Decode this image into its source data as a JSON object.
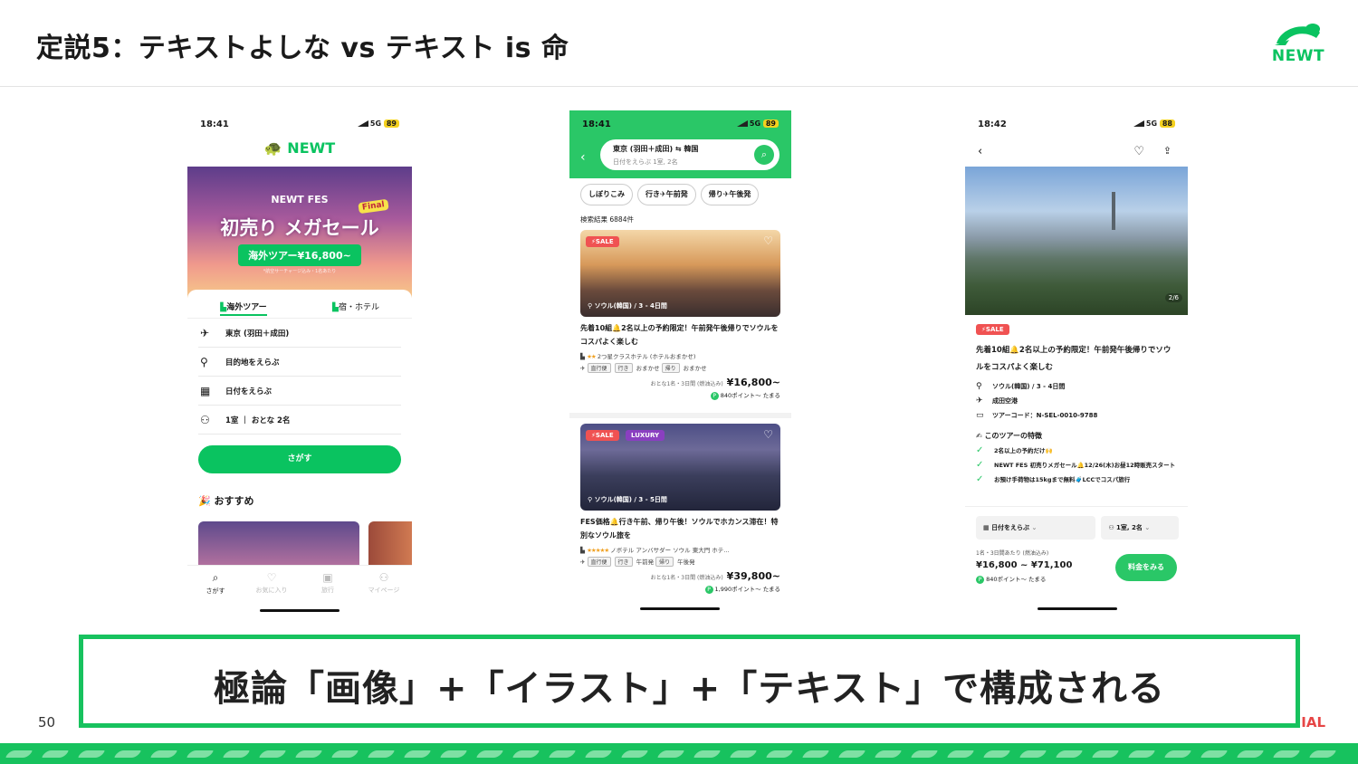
{
  "slide": {
    "title": "定説5：テキストよしな vs テキスト is 命",
    "logo_text": "NEWT",
    "callout": "極論「画像」+「イラスト」+「テキスト」で構成される",
    "page_number": "50",
    "confidential_label": "IAL",
    "accent_color": "#17c25e"
  },
  "phone1": {
    "time": "18:41",
    "network": "5G",
    "battery": "89",
    "app_logo": "NEWT",
    "banner": {
      "fes": "NEWT FES",
      "final": "Final",
      "headline": "初売り メガセール",
      "price": "海外ツアー¥16,800~",
      "note": "*航空サーチャージ込み・1名あたり"
    },
    "tabs": [
      "海外ツアー",
      "宿・ホテル"
    ],
    "fields": [
      "東京 (羽田＋成田)",
      "目的地をえらぶ",
      "日付をえらぶ",
      "1室 ｜ おとな 2名"
    ],
    "search_button": "さがす",
    "recommend_title": "おすすめ",
    "tabbar": [
      "さがす",
      "お気に入り",
      "旅行",
      "マイページ"
    ]
  },
  "phone2": {
    "time": "18:41",
    "network": "5G",
    "battery": "89",
    "search_line1": "東京 (羽田＋成田) ⇆ 韓国",
    "search_line2": "日付をえらぶ 1室, 2名",
    "chips": [
      "しぼりこみ",
      "行き✈午前発",
      "帰り✈午後発"
    ],
    "result_count": "検索結果 6884件",
    "cards": [
      {
        "sale": "SALE",
        "location": "ソウル(韓国) / 3 - 4日間",
        "title": "先着10組🔔2名以上の予約限定！午前発午後帰りでソウルをコスパよく楽しむ",
        "hotel": "2つ星クラスホテル (ホテルおまかせ)",
        "stars": "★★",
        "tag1": "直行便",
        "tag2": "行き",
        "out": "おまかせ",
        "tag3": "帰り",
        "ret": "おまかせ",
        "price_note": "おとな1名・3日間 (燃油込み)",
        "price": "¥16,800~",
        "points": "840ポイント～ たまる"
      },
      {
        "sale": "SALE",
        "luxury": "LUXURY",
        "location": "ソウル(韓国) / 3 - 5日間",
        "title": "FES価格🔔行き午前、帰り午後！ソウルでホカンス滞在！特別なソウル旅を",
        "hotel": "ノボテル アンバサダー ソウル 東大門 ホテ…",
        "stars": "★★★★★",
        "tag1": "直行便",
        "tag2": "行き",
        "out": "午前発",
        "tag3": "帰り",
        "ret": "午後発",
        "price_note": "おとな1名・3日間 (燃油込み)",
        "price": "¥39,800~",
        "points": "1,990ポイント～ たまる"
      }
    ]
  },
  "phone3": {
    "time": "18:42",
    "network": "5G",
    "battery": "88",
    "photo_counter": "2/6",
    "sale": "SALE",
    "title": "先着10組🔔2名以上の予約限定！午前発午後帰りでソウルをコスパよく楽しむ",
    "location": "ソウル(韓国) / 3 - 4日間",
    "airport": "成田空港",
    "tour_code": "ツアーコード：N-SEL-0010-9788",
    "features_title": "このツアーの特徴",
    "features": [
      "2名以上の予約だけ🙌",
      "NEWT FES 初売りメガセール🔔12/26(木)お昼12時販売スタート",
      "お預け手荷物は15kgまで無料🧳LCCでコスパ旅行"
    ],
    "date_select": "日付をえらぶ",
    "room_select": "1室, 2名",
    "price_note": "1名・3日間あたり (燃油込み)",
    "price": "¥16,800 ~ ¥71,100",
    "points": "840ポイント～ たまる",
    "cta": "料金をみる"
  }
}
